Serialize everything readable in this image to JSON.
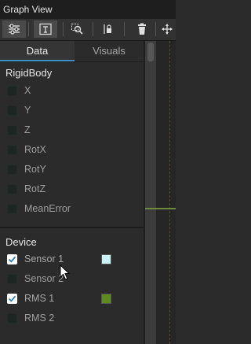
{
  "window": {
    "title": "Graph View"
  },
  "toolbar": {
    "buttons": [
      {
        "icon": "sliders-icon"
      },
      {
        "icon": "text-cursor-icon"
      },
      {
        "icon": "zoom-icon"
      },
      {
        "icon": "lock-icon"
      },
      {
        "icon": "trash-icon"
      },
      {
        "icon": "move-icon"
      }
    ]
  },
  "tabs": {
    "data": "Data",
    "visuals": "Visuals"
  },
  "rigidbody": {
    "title": "RigidBody",
    "items": [
      {
        "label": "X",
        "checked": false
      },
      {
        "label": "Y",
        "checked": false
      },
      {
        "label": "Z",
        "checked": false
      },
      {
        "label": "RotX",
        "checked": false
      },
      {
        "label": "RotY",
        "checked": false
      },
      {
        "label": "RotZ",
        "checked": false
      },
      {
        "label": "MeanError",
        "checked": false
      }
    ]
  },
  "device": {
    "title": "Device",
    "items": [
      {
        "label": "Sensor 1",
        "checked": true,
        "color": "#c9f3f7"
      },
      {
        "label": "Sensor 2",
        "checked": false
      },
      {
        "label": "RMS 1",
        "checked": true,
        "color": "#5e8a1e"
      },
      {
        "label": "RMS 2",
        "checked": false
      }
    ]
  },
  "colors": {
    "accent": "#3a93c7",
    "trace": "#6f8a3a"
  }
}
